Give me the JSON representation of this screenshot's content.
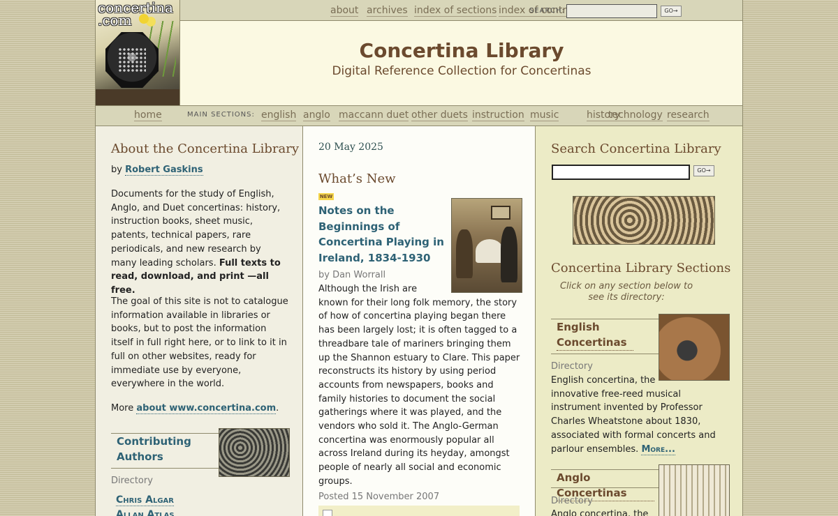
{
  "logo": {
    "text": "concertina\n.com"
  },
  "topnav": {
    "links": [
      "about",
      "archives",
      "index of sections",
      "index of contributors"
    ],
    "search_label": "SEARCH:",
    "go_label": "GO→"
  },
  "masthead": {
    "title": "Concertina Library",
    "subtitle": "Digital Reference Collection for Concertinas"
  },
  "mainnav": {
    "home": "home",
    "sections_label": "MAIN SECTIONS:",
    "links": [
      "english",
      "anglo",
      "maccann duet",
      "other duets",
      "instruction",
      "music",
      "history",
      "technology",
      "research"
    ]
  },
  "left": {
    "heading": "About the Concertina Library",
    "by_prefix": "by",
    "author": "Robert Gaskins",
    "para1": "Documents for the study of English, Anglo, and Duet concertinas: history, instruction books, sheet music, patents, technical papers, rare periodicals, and new research by many leading scholars.",
    "para1_bold": "Full texts to read, download, and print —all free.",
    "para2": "The goal of this site is not to catalogue information available in libraries or books, but to post the information itself in full right here, or to link to it in full on other websites, ready for immediate use by everyone, everywhere in the world.",
    "more_prefix": "More",
    "more_link": "about www.concertina.com",
    "more_suffix": ".",
    "contrib_title": "Contributing Authors",
    "directory": "Directory",
    "contributors": [
      "Chris Algar",
      "Allan Atlas"
    ]
  },
  "mid": {
    "date": "20 May 2025",
    "heading": "What’s New",
    "new_badge": "NEW",
    "article_title": "Notes on the Beginnings of Concertina Playing in Ireland, 1834-1930",
    "byline": "by Dan Worrall",
    "body": "Although the Irish are known for their long folk memory, the story of how of concertina playing began there has been largely lost; it is often tagged to a threadbare tale of mariners bringing them up the Shannon estuary to Clare. This paper reconstructs its history by using period accounts from newspapers, books and family histories to document the social gatherings where it was played, and the vendors who sold it. The Anglo-German concertina was enormously popular all across Ireland during its heyday, amongst people of nearly all social and economic groups.",
    "posted": "Posted 15 November 2007"
  },
  "right": {
    "search_heading": "Search Concertina Library",
    "go_label": "GO→",
    "sections_heading": "Concertina Library Sections",
    "sections_hint": "Click on any section below to see its directory:",
    "english_title": "English Concertinas",
    "directory": "Directory",
    "english_desc": "English concertina, the innovative free-reed musical instrument invented by Professor Charles Wheatstone about 1830, associated with formal concerts and parlour ensembles.",
    "more_label": "More...",
    "anglo_title": "Anglo Concertinas",
    "anglo_desc": "Anglo concertina, the"
  }
}
